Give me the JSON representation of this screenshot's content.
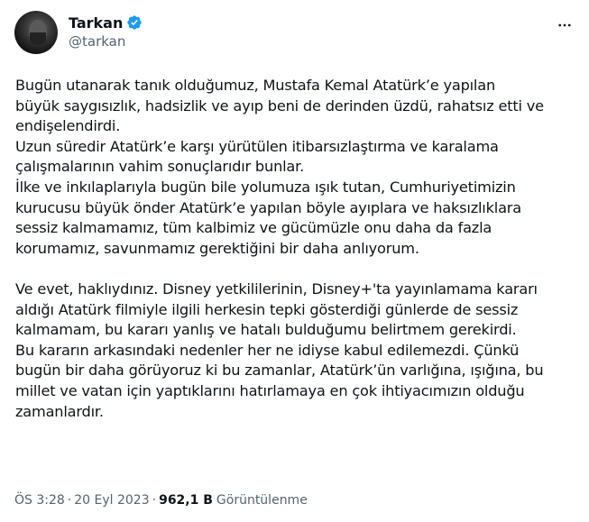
{
  "author": {
    "display_name": "Tarkan",
    "handle": "@tarkan",
    "verified_color": "#1d9bf0"
  },
  "tweet": {
    "lines_block1": [
      "Bugün utanarak tanık olduğumuz, Mustafa Kemal Atatürk’e yapılan",
      "büyük saygısızlık, hadsizlik ve ayıp beni de derinden üzdü, rahatsız etti ve",
      "endişelendirdi.",
      "Uzun süredir Atatürk’e karşı yürütülen itibarsızlaştırma ve karalama",
      "çalışmalarının vahim sonuçlarıdır bunlar.",
      "İlke ve inkılaplarıyla bugün bile yolumuza ışık tutan, Cumhuriyetimizin",
      "kurucusu büyük önder Atatürk’e yapılan böyle ayıplara ve haksızlıklara",
      "sessiz kalmamamız, tüm kalbimiz ve gücümüzle onu daha da fazla",
      "korumamız, savunmamız gerektiğini bir daha anlıyorum."
    ],
    "lines_block2": [
      "Ve evet, haklıydınız. Disney yetkililerinin, Disney+'ta yayınlamama kararı",
      "aldığı Atatürk filmiyle ilgili herkesin tepki gösterdiği günlerde de sessiz",
      "kalmamam, bu kararı yanlış ve hatalı bulduğumu belirtmem gerekirdi.",
      "Bu kararın arkasındaki nedenler her ne idiyse kabul edilemezdi. Çünkü",
      "bugün bir daha görüyoruz ki bu zamanlar, Atatürk’ün varlığına, ışığına, bu",
      "millet ve vatan için yaptıklarını hatırlamaya en çok ihtiyacımızın olduğu",
      "zamanlardır."
    ]
  },
  "meta": {
    "time": "ÖS 3:28",
    "separator": "·",
    "date": "20 Eyl 2023",
    "views_count": "962,1 B",
    "views_label": "Görüntülenme"
  },
  "icons": {
    "more": "more-horizontal-icon",
    "verified": "verified-badge-icon"
  }
}
